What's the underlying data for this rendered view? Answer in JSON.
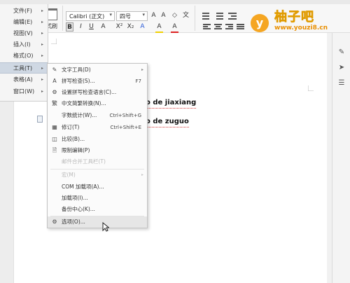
{
  "ribbon": {
    "paste_label": "式刷",
    "font_name": "Calibri (正文)",
    "font_size": "四号",
    "format_tools": [
      "B",
      "I",
      "U",
      "A",
      "X²",
      "X₂",
      "A",
      "A",
      "A"
    ]
  },
  "main_menu": {
    "items": [
      {
        "label": "文件(F)",
        "active": false
      },
      {
        "label": "编辑(E)",
        "active": false
      },
      {
        "label": "视图(V)",
        "active": false
      },
      {
        "label": "插入(I)",
        "active": false
      },
      {
        "label": "格式(O)",
        "active": false
      },
      {
        "label": "工具(T)",
        "active": true
      },
      {
        "label": "表格(A)",
        "active": false
      },
      {
        "label": "窗口(W)",
        "active": false
      }
    ]
  },
  "tools_menu": {
    "items": [
      {
        "label": "文字工具(D)",
        "shortcut": "",
        "icon": "text-tool-icon",
        "has_submenu": true,
        "disabled": false
      },
      {
        "label": "拼写检查(S)...",
        "shortcut": "F7",
        "icon": "spell-check-icon",
        "has_submenu": false,
        "disabled": false
      },
      {
        "label": "设置拼写检查语言(C)...",
        "shortcut": "",
        "icon": "spell-language-icon",
        "has_submenu": false,
        "disabled": false
      },
      {
        "label": "中文简繁转换(N)...",
        "shortcut": "",
        "icon": "chinese-convert-icon",
        "has_submenu": false,
        "disabled": false
      },
      {
        "label": "字数统计(W)...",
        "shortcut": "Ctrl+Shift+G",
        "icon": "",
        "has_submenu": false,
        "disabled": false
      },
      {
        "label": "修订(T)",
        "shortcut": "Ctrl+Shift+E",
        "icon": "track-changes-icon",
        "has_submenu": false,
        "disabled": false
      },
      {
        "label": "比较(B)...",
        "shortcut": "",
        "icon": "compare-icon",
        "has_submenu": false,
        "disabled": false
      },
      {
        "label": "限制编辑(P)",
        "shortcut": "",
        "icon": "restrict-edit-icon",
        "has_submenu": false,
        "disabled": false
      },
      {
        "label": "邮件合并工具栏(T)",
        "shortcut": "",
        "icon": "",
        "has_submenu": false,
        "disabled": true
      },
      {
        "label": "宏(M)",
        "shortcut": "",
        "icon": "",
        "has_submenu": true,
        "disabled": true
      },
      {
        "label": "COM 加载项(A)...",
        "shortcut": "",
        "icon": "",
        "has_submenu": false,
        "disabled": false
      },
      {
        "label": "加载项(I)...",
        "shortcut": "",
        "icon": "",
        "has_submenu": false,
        "disabled": false
      },
      {
        "label": "备份中心(K)...",
        "shortcut": "",
        "icon": "",
        "has_submenu": false,
        "disabled": false
      },
      {
        "label": "选项(O)...",
        "shortcut": "",
        "icon": "gear-icon",
        "has_submenu": false,
        "disabled": false,
        "hover": true
      }
    ]
  },
  "document": {
    "lines": [
      "o de jiaxiang",
      "o de zuguo"
    ]
  },
  "watermark": {
    "title": "柚子吧",
    "url": "www.youzi8.cn",
    "badge": "y"
  },
  "colors": {
    "menu_active": "#cfd8e3",
    "hover": "#e6e6e6",
    "logo_title": "#ffcd21",
    "logo_url": "#e98f00",
    "logo_circle": "#f5a623"
  }
}
